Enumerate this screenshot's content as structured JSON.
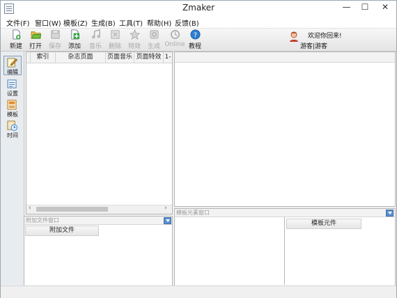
{
  "window": {
    "title": "Zmaker",
    "minimize_glyph": "—",
    "maximize_glyph": "☐",
    "close_glyph": "✕"
  },
  "menu": [
    {
      "label": "文件(F)"
    },
    {
      "label": "窗口(W)"
    },
    {
      "label": "模板(Z)"
    },
    {
      "label": "生成(B)"
    },
    {
      "label": "工具(T)"
    },
    {
      "label": "帮助(H)"
    },
    {
      "label": "反馈(B)"
    }
  ],
  "toolbar": {
    "items": [
      {
        "label": "新建",
        "icon": "new-file-icon",
        "enabled": true
      },
      {
        "label": "打开",
        "icon": "open-folder-icon",
        "enabled": true
      },
      {
        "label": "保存",
        "icon": "save-icon",
        "enabled": false
      },
      {
        "label": "添加",
        "icon": "add-page-icon",
        "enabled": true
      },
      {
        "label": "音乐",
        "icon": "music-icon",
        "enabled": false
      },
      {
        "label": "删除",
        "icon": "delete-icon",
        "enabled": false
      },
      {
        "label": "特效",
        "icon": "effects-icon",
        "enabled": false
      },
      {
        "label": "生成",
        "icon": "build-icon",
        "enabled": false
      },
      {
        "label": "Online",
        "icon": "online-icon",
        "enabled": false
      },
      {
        "label": "教程",
        "icon": "help-icon",
        "enabled": true
      }
    ],
    "welcome": "欢迎你回来!",
    "user": "游客|游客"
  },
  "sidebar": [
    {
      "label": "编辑",
      "icon": "edit-icon",
      "active": true
    },
    {
      "label": "设置",
      "icon": "settings-icon",
      "active": false
    },
    {
      "label": "模板",
      "icon": "template-icon",
      "active": false
    },
    {
      "label": "时间",
      "icon": "clock-icon",
      "active": false
    }
  ],
  "page_grid": {
    "columns": [
      "索引",
      "杂志页面",
      "页面音乐",
      "页面特效",
      "1-"
    ],
    "scroll_left": "‹",
    "scroll_right": "›"
  },
  "attach_panel": {
    "title": "附加文件窗口",
    "column": "附加文件"
  },
  "template_panel": {
    "title": "模板元素窗口",
    "column": "模板元件"
  },
  "colors": {
    "dropdown": "#5b8fcf",
    "accent_blue": "#2f7fd1"
  }
}
